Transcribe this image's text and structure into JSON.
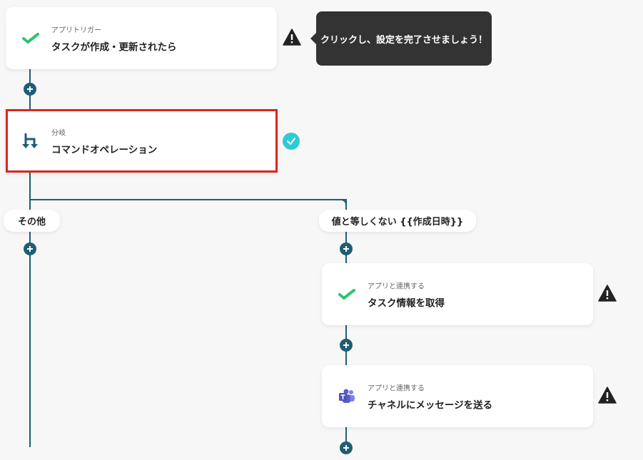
{
  "nodes": {
    "trigger": {
      "sub": "アプリトリガー",
      "title": "タスクが作成・更新されたら"
    },
    "branch": {
      "sub": "分岐",
      "title": "コマンドオペレーション"
    },
    "get_task": {
      "sub": "アプリと連携する",
      "title": "タスク情報を取得"
    },
    "send_message": {
      "sub": "アプリと連携する",
      "title": "チャネルにメッセージを送る"
    }
  },
  "tooltip": {
    "text": "クリックし、設定を完了させましょう！"
  },
  "branches": {
    "other": "その他",
    "not_equal": "値と等しくない {{作成日時}}"
  },
  "colors": {
    "line": "#1f5d73",
    "selected_border": "#d9261c",
    "check": "#2ecad6",
    "tooltip_bg": "#333333",
    "app_green": "#2fc46d",
    "teams_purple": "#5b5fc7"
  }
}
